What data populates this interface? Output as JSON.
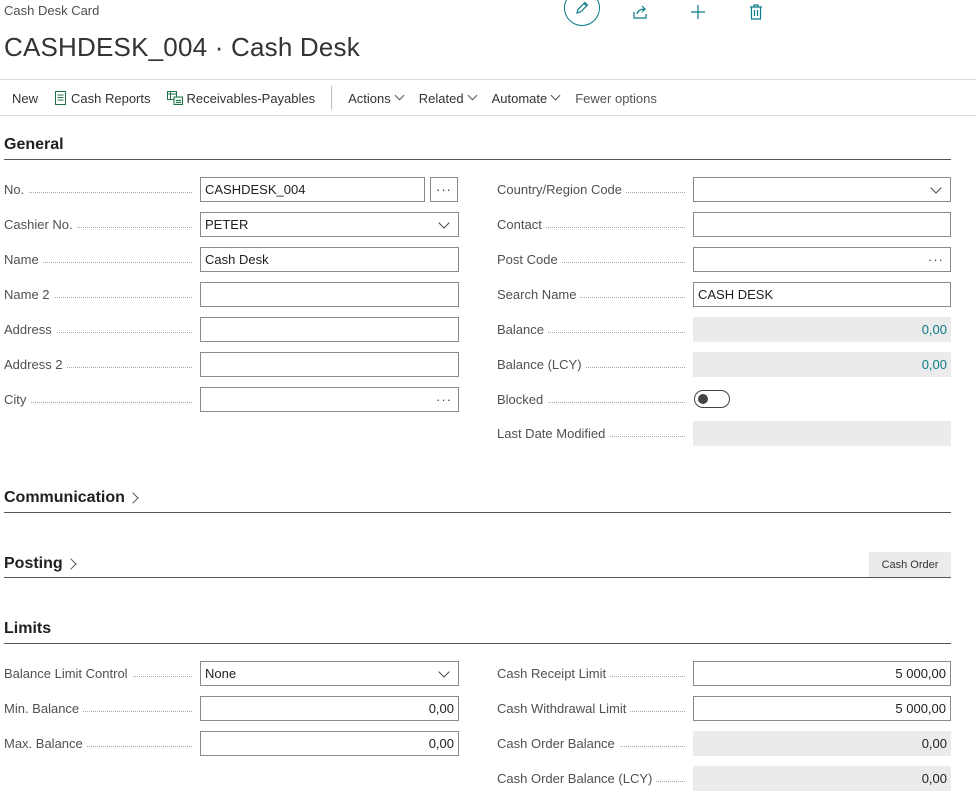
{
  "breadcrumb": "Cash Desk Card",
  "title": "CASHDESK_004 · Cash Desk",
  "top_icons": [
    "pencil-icon",
    "share-icon",
    "plus-icon",
    "delete-icon"
  ],
  "actions": {
    "new": "New",
    "cash_reports": "Cash Reports",
    "receivables_payables": "Receivables-Payables",
    "actions": "Actions",
    "related": "Related",
    "automate": "Automate",
    "fewer_options": "Fewer options"
  },
  "sections": {
    "general": "General",
    "communication": "Communication",
    "posting": "Posting",
    "limits": "Limits"
  },
  "posting_button": "Cash Order",
  "general": {
    "left": [
      {
        "label": "No.",
        "value": "CASHDESK_004"
      },
      {
        "label": "Cashier No.",
        "value": "PETER"
      },
      {
        "label": "Name",
        "value": "Cash Desk"
      },
      {
        "label": "Name 2",
        "value": ""
      },
      {
        "label": "Address",
        "value": ""
      },
      {
        "label": "Address 2",
        "value": ""
      },
      {
        "label": "City",
        "value": ""
      }
    ],
    "right": [
      {
        "label": "Country/Region Code",
        "value": ""
      },
      {
        "label": "Contact",
        "value": ""
      },
      {
        "label": "Post Code",
        "value": ""
      },
      {
        "label": "Search Name",
        "value": "CASH DESK"
      },
      {
        "label": "Balance",
        "value": "0,00"
      },
      {
        "label": "Balance (LCY)",
        "value": "0,00"
      },
      {
        "label": "Blocked",
        "value": false
      },
      {
        "label": "Last Date Modified",
        "value": ""
      }
    ]
  },
  "limits": {
    "left": [
      {
        "label": "Balance Limit Control",
        "value": "None"
      },
      {
        "label": "Min. Balance",
        "value": "0,00"
      },
      {
        "label": "Max. Balance",
        "value": "0,00"
      }
    ],
    "right": [
      {
        "label": "Cash Receipt Limit",
        "value": "5 000,00"
      },
      {
        "label": "Cash Withdrawal Limit",
        "value": "5 000,00"
      },
      {
        "label": "Cash Order Balance",
        "value": "0,00"
      },
      {
        "label": "Cash Order Balance (LCY)",
        "value": "0,00"
      }
    ]
  },
  "colors": {
    "accent": "#0a7c86",
    "readonly_bg": "#ebebeb",
    "icon_green": "#1e7145"
  }
}
